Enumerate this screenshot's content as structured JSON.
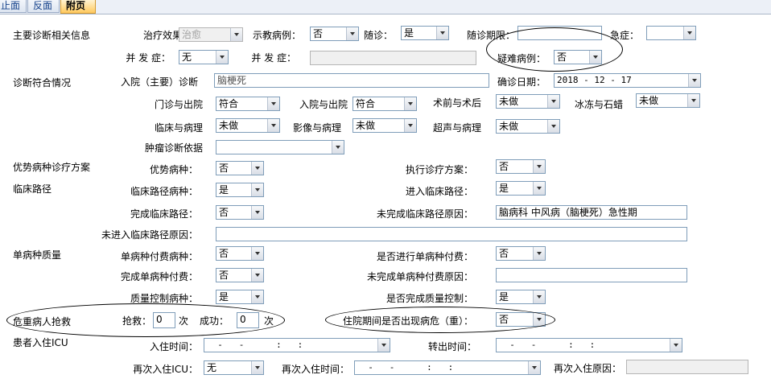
{
  "tabs": [
    {
      "label": "止面",
      "active": false
    },
    {
      "label": "反面",
      "active": false
    },
    {
      "label": "附页",
      "active": true
    }
  ],
  "sections": {
    "main_diag": "主要诊断相关信息",
    "diag_match": "诊断符合情况",
    "advantage": "优势病种诊疗方案",
    "pathway": "临床路径",
    "single": "单病种质量",
    "critical": "危重病人抢救",
    "icu": "患者入住ICU"
  },
  "labels": {
    "treat_effect": "治疗效果：",
    "teaching_case": "示教病例：",
    "followup": "随诊：",
    "followup_period": "随诊期限：",
    "emergency": "急症：",
    "complication1": "并 发 症：",
    "complication2": "并 发 症：",
    "difficult_case": "疑难病例：",
    "admit_diag": "入院（主要）诊断",
    "confirm_date": "确诊日期：",
    "outpatient_discharge": "门诊与出院",
    "admit_discharge": "入院与出院",
    "preop_postop": "术前与术后",
    "frozen_paraffin": "冰冻与石蜡",
    "clinical_pathology": "临床与病理",
    "imaging_pathology": "影像与病理",
    "ultrasound_pathology": "超声与病理",
    "tumor_basis": "肿瘤诊断依据",
    "adv_disease": "优势病种：",
    "exec_plan": "执行诊疗方案：",
    "path_disease": "临床路径病种：",
    "enter_path": "进入临床路径：",
    "complete_path": "完成临床路径：",
    "incomplete_reason": "未完成临床路径原因：",
    "not_enter_reason": "未进入临床路径原因：",
    "single_fee_disease": "单病种付费病种：",
    "single_fee_done": "是否进行单病种付费：",
    "complete_single_fee": "完成单病种付费：",
    "incomplete_single_reason": "未完成单病种付费原因：",
    "qc_disease": "质量控制病种：",
    "qc_complete": "是否完成质量控制：",
    "rescue": "抢救：",
    "times1": "次",
    "success": "成功：",
    "times2": "次",
    "critical_during": "住院期间是否出现病危（重）：",
    "icu_in": "入住时间：",
    "icu_out": "转出时间：",
    "reicu": "再次入住ICU：",
    "reicu_time": "再次入住时间：",
    "reicu_reason": "再次入住原因："
  },
  "values": {
    "treat_effect": "治愈",
    "teaching_case": "否",
    "followup": "是",
    "followup_period": "",
    "emergency": "",
    "complication1": "无",
    "complication2": "",
    "difficult_case": "否",
    "admit_diag": "脑梗死",
    "confirm_date": "2018 - 12 - 17",
    "outpatient_discharge": "符合",
    "admit_discharge": "符合",
    "preop_postop": "未做",
    "frozen_paraffin": "未做",
    "clinical_pathology": "未做",
    "imaging_pathology": "未做",
    "ultrasound_pathology": "未做",
    "tumor_basis": "",
    "adv_disease": "否",
    "exec_plan": "否",
    "path_disease": "是",
    "enter_path": "是",
    "complete_path": "否",
    "incomplete_reason": "脑病科 中风病（脑梗死）急性期",
    "not_enter_reason": "",
    "single_fee_disease": "否",
    "single_fee_done": "否",
    "complete_single_fee": "否",
    "incomplete_single_reason": "",
    "qc_disease": "是",
    "qc_complete": "是",
    "rescue_count": "0",
    "success_count": "0",
    "critical_during": "否",
    "icu_in": "  -   -      :   :",
    "icu_out": "  -   -      :   :",
    "reicu": "无",
    "reicu_time": "  -   -      :   :",
    "reicu_reason": ""
  }
}
